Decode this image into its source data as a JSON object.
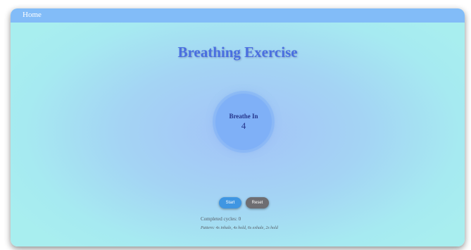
{
  "nav": {
    "home_label": "Home"
  },
  "page": {
    "title": "Breathing Exercise"
  },
  "breath": {
    "phase": "Breathe In",
    "count": "4"
  },
  "controls": {
    "start_label": "Start",
    "reset_label": "Reset"
  },
  "stats": {
    "cycles_text": "Completed cycles: 0",
    "pattern_text": "Pattern: 4s inhale, 4s hold, 6s exhale, 2s hold"
  },
  "colors": {
    "topbar": "#82bcf8",
    "title": "#4a6fe0",
    "circle": "#7fb0f7",
    "start_button": "#3f96e2",
    "reset_button": "#6e6e72"
  }
}
